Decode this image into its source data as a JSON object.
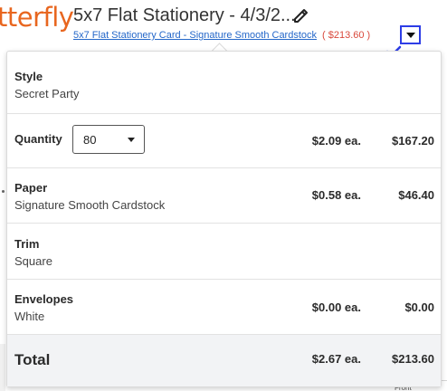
{
  "header": {
    "brand_fragment": "tterfly",
    "title": "5x7 Flat Stationery - 4/3/2...",
    "subtitle_link": "5x7 Flat Stationery Card - Signature Smooth Cardstock",
    "subtitle_price": "( $213.60 )"
  },
  "background": {
    "front_label": "Front"
  },
  "panel": {
    "rows": [
      {
        "label": "Style",
        "value": "Secret Party",
        "each": "",
        "total": ""
      },
      {
        "label": "Quantity",
        "value": "",
        "each": "$2.09 ea.",
        "total": "$167.20"
      },
      {
        "label": "Paper",
        "value": "Signature Smooth Cardstock",
        "each": "$0.58 ea.",
        "total": "$46.40"
      },
      {
        "label": "Trim",
        "value": "Square",
        "each": "",
        "total": ""
      },
      {
        "label": "Envelopes",
        "value": "White",
        "each": "$0.00 ea.",
        "total": "$0.00"
      }
    ],
    "quantity_selected": "80",
    "total": {
      "label": "Total",
      "each": "$2.67 ea.",
      "total": "$213.60"
    }
  },
  "colors": {
    "brand_orange": "#e8661f",
    "link_blue": "#2467c9",
    "price_red": "#d9483b",
    "annotation_blue": "#2d3de6"
  },
  "icons": {
    "edit": "pencil-icon",
    "dropdown": "caret-down-icon",
    "annotation": "arrow-down-left-icon"
  }
}
